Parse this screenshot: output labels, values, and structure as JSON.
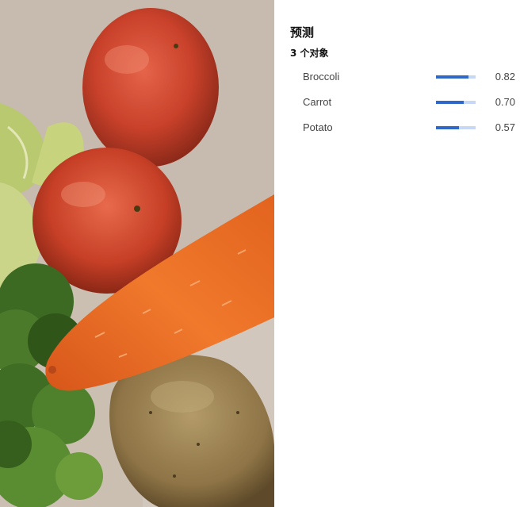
{
  "predictions": {
    "title": "预测",
    "count_label": "3 个对象",
    "items": [
      {
        "label": "Broccoli",
        "score": "0.82",
        "value": 0.82
      },
      {
        "label": "Carrot",
        "score": "0.70",
        "value": 0.7
      },
      {
        "label": "Potato",
        "score": "0.57",
        "value": 0.57
      }
    ],
    "bar_color": "#2f68c8",
    "bar_track_color": "#c6d8f5"
  },
  "image": {
    "subject_icons": [
      "tomato",
      "tomato",
      "carrot",
      "potato",
      "broccoli",
      "cabbage"
    ]
  }
}
